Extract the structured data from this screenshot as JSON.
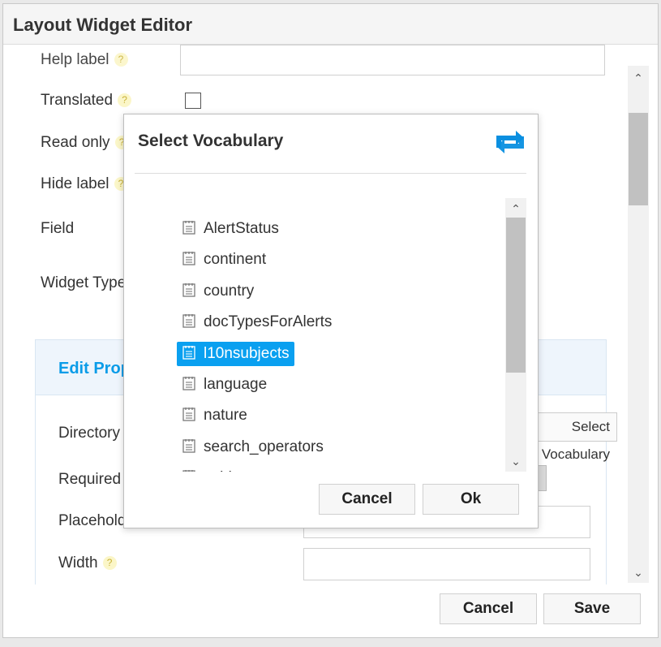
{
  "editor": {
    "title": "Layout Widget Editor",
    "fields": {
      "help_label": "Help label",
      "translated": "Translated",
      "read_only": "Read only",
      "hide_label": "Hide label",
      "field": "Field",
      "widget_type": "Widget Type"
    },
    "help_glyph": "?",
    "properties": {
      "title": "Edit Properties",
      "directory": "Directory",
      "vocabulary_button": "Select Vocabulary",
      "required": "Required",
      "placeholder": "Placeholder",
      "width": "Width"
    },
    "footer": {
      "cancel": "Cancel",
      "save": "Save"
    }
  },
  "dialog": {
    "title": "Select Vocabulary",
    "items": [
      {
        "label": "AlertStatus",
        "selected": false
      },
      {
        "label": "continent",
        "selected": false
      },
      {
        "label": "country",
        "selected": false
      },
      {
        "label": "docTypesForAlerts",
        "selected": false
      },
      {
        "label": "l10nsubjects",
        "selected": true
      },
      {
        "label": "language",
        "selected": false
      },
      {
        "label": "nature",
        "selected": false
      },
      {
        "label": "search_operators",
        "selected": false
      },
      {
        "label": "subject",
        "selected": false
      }
    ],
    "buttons": {
      "cancel": "Cancel",
      "ok": "Ok"
    }
  },
  "colors": {
    "accent": "#0aa0f0",
    "swap_icon": "#0a8fe0",
    "properties_title": "#0a9ce8"
  },
  "icons": {
    "list_item": "document-icon",
    "dialog_header": "swap-arrows-icon",
    "help": "help-icon",
    "scroll_up": "chevron-up-icon",
    "scroll_down": "chevron-down-icon"
  }
}
